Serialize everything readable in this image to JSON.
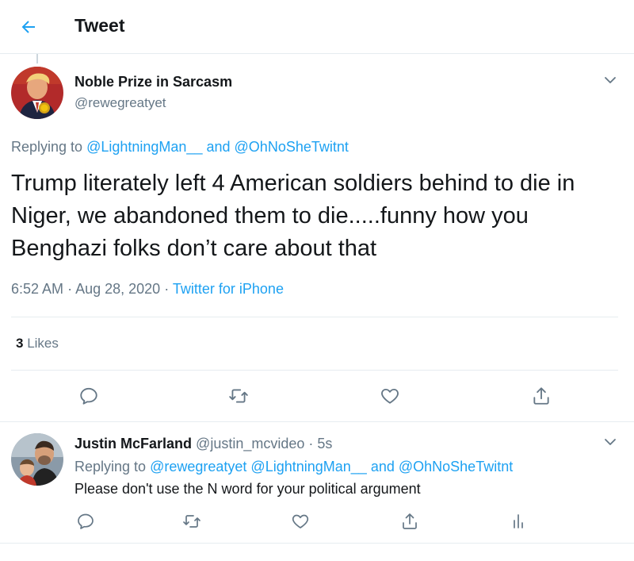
{
  "header": {
    "title": "Tweet",
    "back_icon": "back-arrow-icon"
  },
  "colors": {
    "accent": "#1da1f2",
    "text": "#14171a",
    "secondary": "#657786",
    "border": "#e6ecf0"
  },
  "main_tweet": {
    "author_name": "Noble Prize in Sarcasm",
    "author_handle": "@rewegreatyet",
    "replying_prefix": "Replying to",
    "replying_mention_1": "@LightningMan__",
    "replying_and": "and",
    "replying_mention_2": "@OhNoSheTwitnt",
    "text": "Trump literately left 4 American soldiers behind to die in Niger, we abandoned them to die.....funny how you Benghazi folks don’t care about that",
    "time": "6:52 AM",
    "date": "Aug 28, 2020",
    "separator": "·",
    "source": "Twitter for iPhone",
    "likes_count": "3",
    "likes_label": "Likes",
    "actions": [
      "reply-icon",
      "retweet-icon",
      "like-icon",
      "share-icon"
    ]
  },
  "reply_tweet": {
    "author_name": "Justin McFarland",
    "author_handle": "@justin_mcvideo",
    "separator": "·",
    "time_ago": "5s",
    "replying_prefix": "Replying to",
    "replying_mention_1": "@rewegreatyet",
    "replying_mention_2": "@LightningMan__",
    "replying_and": "and",
    "replying_mention_3": "@OhNoSheTwitnt",
    "text": "Please don't use the N word for your political argument",
    "actions": [
      "reply-icon",
      "retweet-icon",
      "like-icon",
      "share-icon",
      "analytics-icon"
    ]
  }
}
